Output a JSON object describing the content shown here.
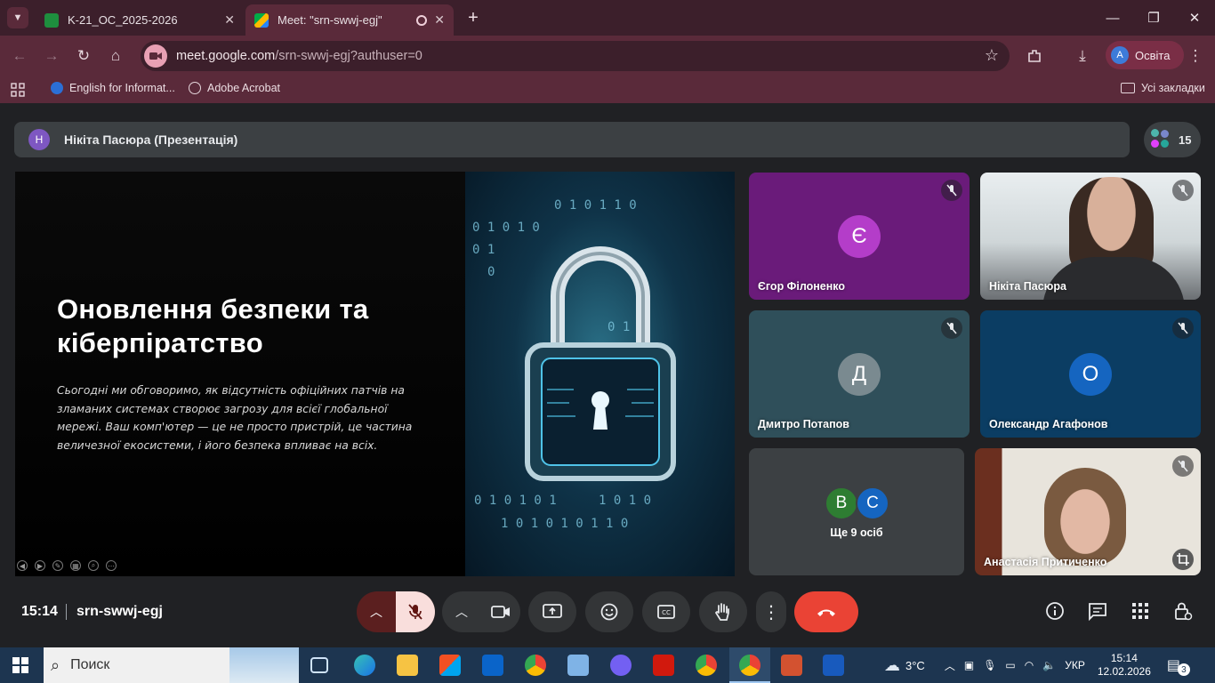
{
  "browser": {
    "tabs": [
      {
        "title": "K-21_ОС_2025-2026",
        "active": false
      },
      {
        "title": "Meet: \"srn-swwj-egj\"",
        "active": true
      }
    ],
    "url_host": "meet.google.com",
    "url_path": "/srn-swwj-egj?authuser=0",
    "profile_initial": "A",
    "profile_name": "Освіта",
    "bookmarks": [
      "English for Informat...",
      "Adobe Acrobat"
    ],
    "all_bookmarks": "Усі закладки"
  },
  "meet": {
    "presenter_initial": "Н",
    "presenter_label": "Нікіта Пасюра (Презентація)",
    "people_count": "15",
    "slide": {
      "title": "Оновлення безпеки та кіберпіратство",
      "body": "Сьогодні ми обговоримо, як відсутність офіційних патчів на зламаних системах створює загрозу для всієї глобальної мережі. Ваш комп'ютер — це не просто пристрій, це частина величезної екосистеми, і його безпека впливає на всіх."
    },
    "participants": [
      {
        "name": "Єгор Філоненко",
        "initial": "Є",
        "muted": true
      },
      {
        "name": "Нікіта Пасюра",
        "initial": "",
        "muted": true
      },
      {
        "name": "Дмитро Потапов",
        "initial": "Д",
        "muted": true
      },
      {
        "name": "Олександр Агафонов",
        "initial": "О",
        "muted": true
      },
      {
        "name": "Ще 9 осіб",
        "initials": [
          "В",
          "С"
        ]
      },
      {
        "name": "Анастасія Притиченко",
        "initial": "",
        "muted": true
      }
    ],
    "time": "15:14",
    "meeting_code": "srn-swwj-egj"
  },
  "taskbar": {
    "search_placeholder": "Поиск",
    "weather": "3°C",
    "lang": "УКР",
    "time": "15:14",
    "date": "12.02.2026",
    "notifications": "3"
  },
  "colors": {
    "tile_yehor": "#6a1b7a",
    "tile_dmytro": "#2f4f5a",
    "tile_oleksandr": "#0b3d63",
    "end_call": "#ea4335"
  }
}
